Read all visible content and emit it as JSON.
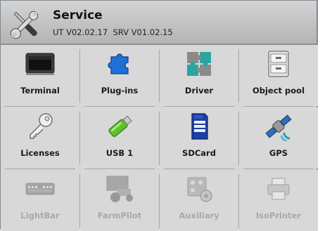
{
  "header": {
    "title": "Service",
    "subtitle": "UT V02.02.17  SRV V01.02.15",
    "icon": "tools-icon"
  },
  "tiles": [
    {
      "label": "Terminal",
      "icon": "terminal-icon",
      "enabled": true
    },
    {
      "label": "Plug-ins",
      "icon": "puzzle-piece-icon",
      "enabled": true
    },
    {
      "label": "Driver",
      "icon": "puzzle-icon",
      "enabled": true
    },
    {
      "label": "Object pool",
      "icon": "file-cabinet-icon",
      "enabled": true
    },
    {
      "label": "Licenses",
      "icon": "key-icon",
      "enabled": true
    },
    {
      "label": "USB 1",
      "icon": "usb-stick-icon",
      "enabled": true
    },
    {
      "label": "SDCard",
      "icon": "sd-card-icon",
      "enabled": true
    },
    {
      "label": "GPS",
      "icon": "satellite-icon",
      "enabled": true
    },
    {
      "label": "LightBar",
      "icon": "lightbar-icon",
      "enabled": false
    },
    {
      "label": "FarmPilot",
      "icon": "tractor-monitor-icon",
      "enabled": false
    },
    {
      "label": "Auxiliary",
      "icon": "auxiliary-icon",
      "enabled": false
    },
    {
      "label": "IsoPrinter",
      "icon": "printer-icon",
      "enabled": false
    }
  ],
  "colors": {
    "tile_background": "#d8d8d8",
    "header_background": "#c4c4c4",
    "disabled_text": "#a8a8a8"
  }
}
